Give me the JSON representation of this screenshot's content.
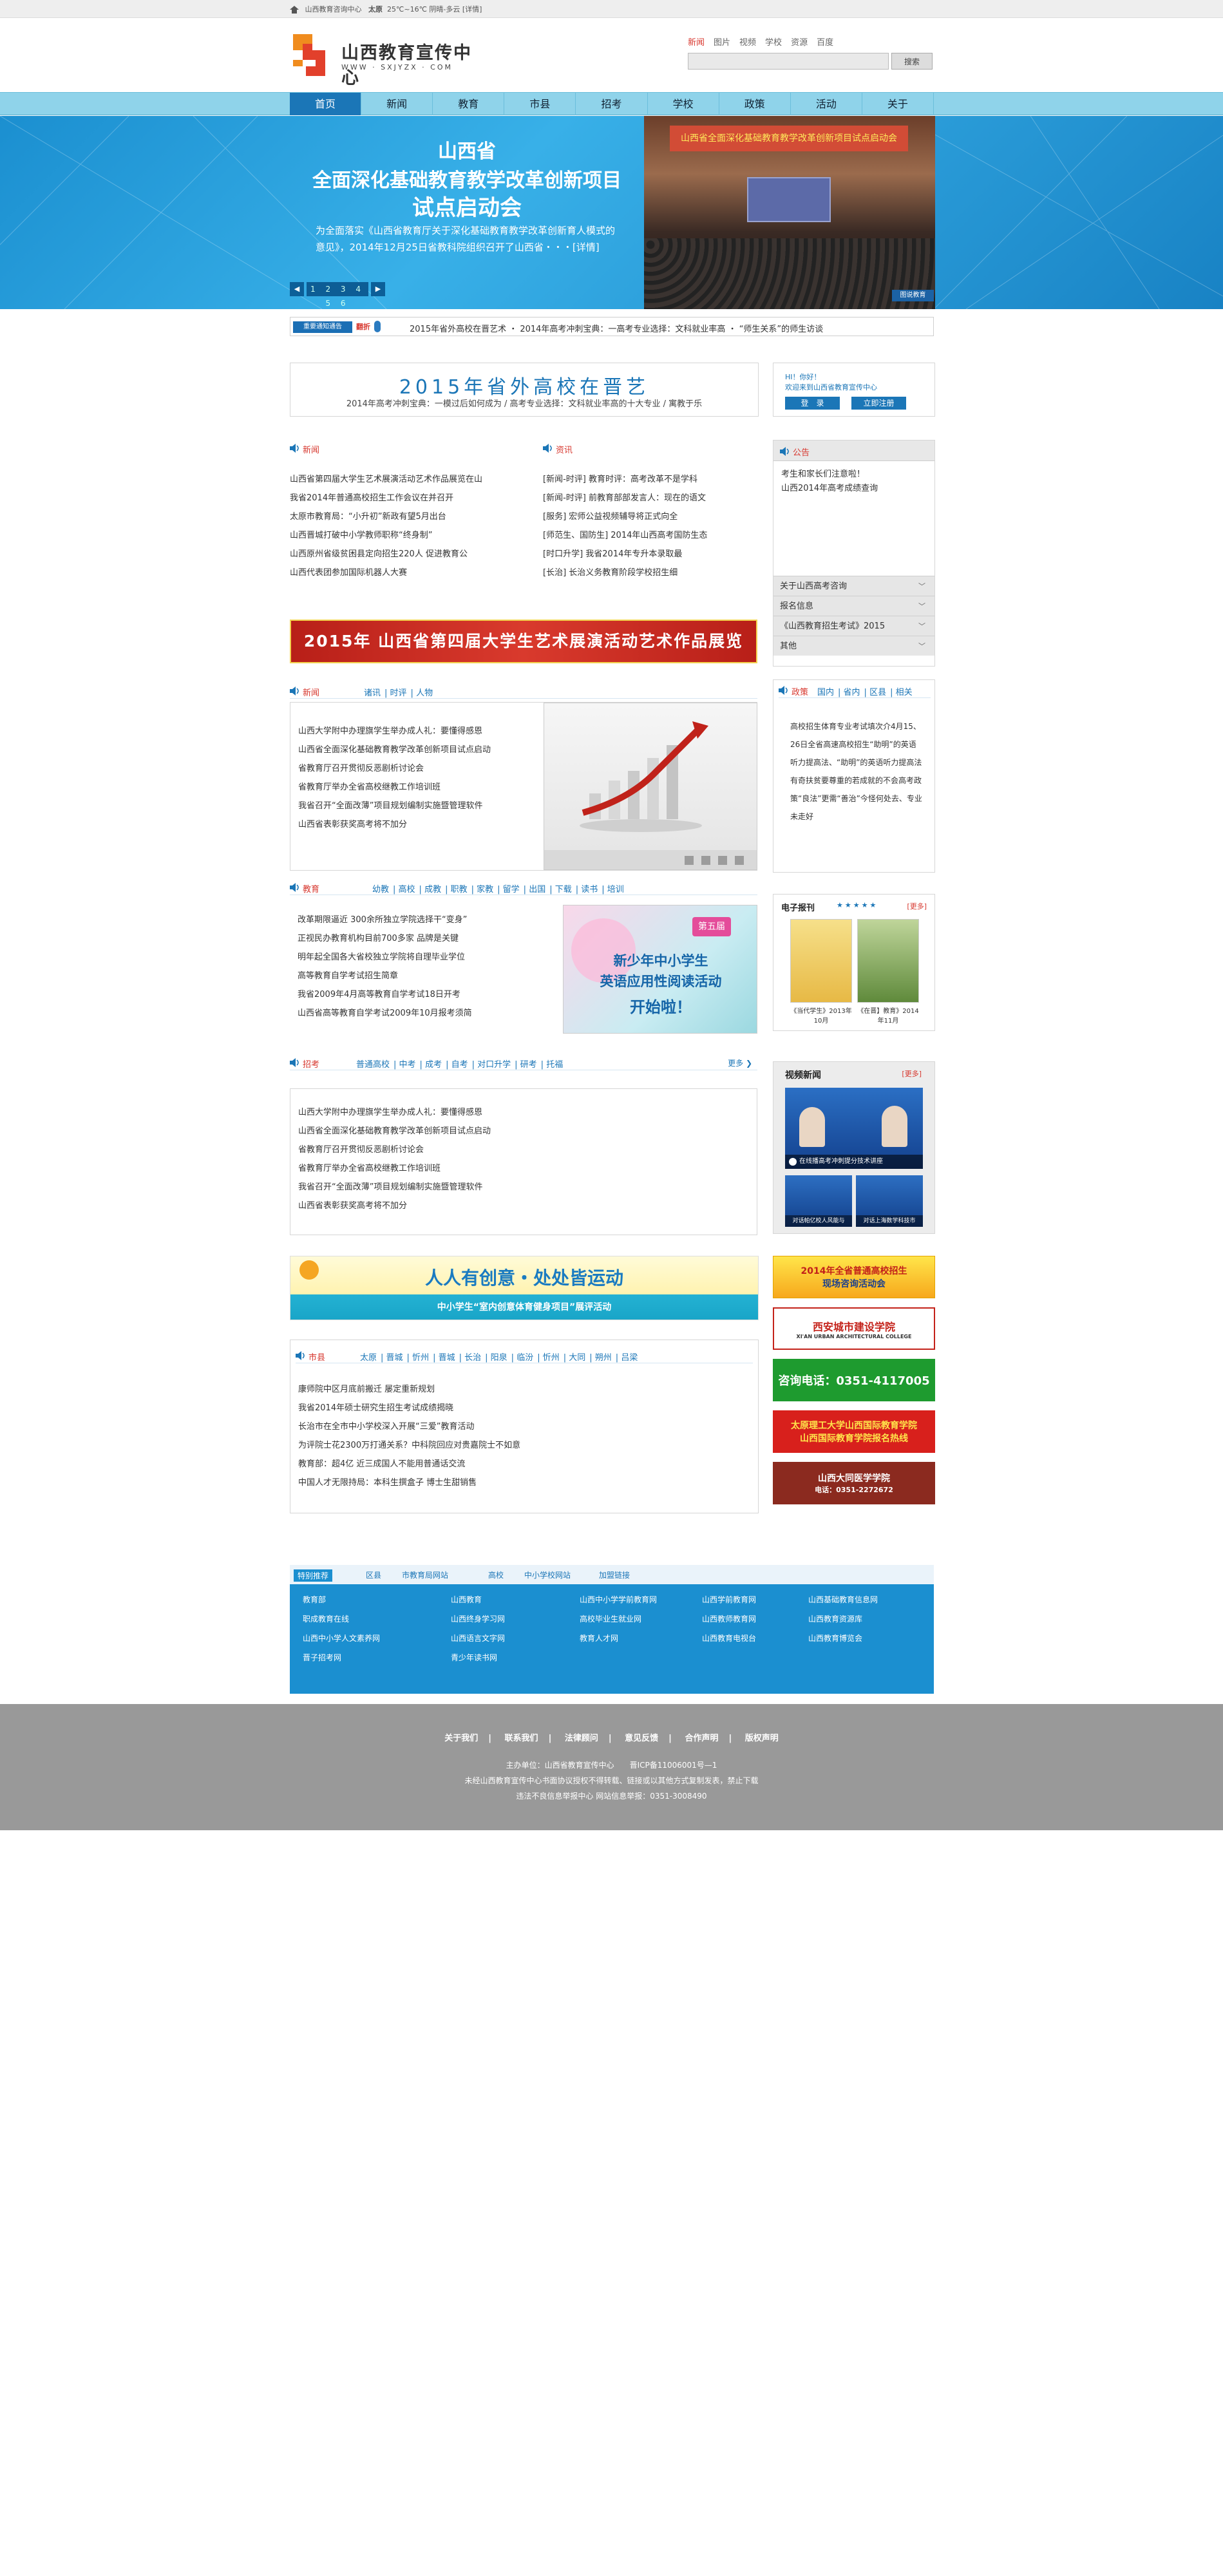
{
  "topbar": {
    "site": "山西教育咨询中心",
    "city": "太原",
    "weather": "25℃~16℃ 阴晴-多云 [详情]"
  },
  "logo": {
    "title": "山西教育宣传中心",
    "url": "WWW · SXJYZX · COM"
  },
  "search": {
    "tabs": [
      "新闻",
      "图片",
      "视频",
      "学校",
      "资源",
      "百度"
    ],
    "placeholder": "",
    "button": "搜索"
  },
  "nav": [
    "首页",
    "新闻",
    "教育",
    "市县",
    "招考",
    "学校",
    "政策",
    "活动",
    "关于"
  ],
  "banner": {
    "line1": "山西省",
    "line2": "全面深化基础教育教学改革创新项目",
    "line3": "试点启动会",
    "desc": "为全面落实《山西省教育厅关于深化基础教育教学改革创新育人模式的意见》，2014年12月25日省教科院组织召开了山西省・・・[详情]",
    "pager": "1 2 3 4 5 6",
    "photo_stage": "山西省全面深化基础教育教学改革创新项目试点启动会",
    "photo_btn": "图说教育"
  },
  "notice": {
    "tag": "重要通知通告",
    "label": "翻折",
    "text": "2015年省外高校在晋艺术 ・ 2014年高考冲刺宝典：一高考专业选择：文科就业率高 ・ “师生关系”的师生访谈"
  },
  "headline": {
    "title": "2015年省外高校在晋艺",
    "sub": "2014年高考冲刺宝典：一模过后如何成为   /   高考专业选择：文科就业率高的十大专业   /   寓教于乐"
  },
  "login": {
    "greet": "HI！你好！",
    "welcome": "欢迎来到山西省教育宣传中心",
    "login": "登　录",
    "register": "立即注册"
  },
  "news": {
    "title": "新闻",
    "items": [
      "山西省第四届大学生艺术展演活动艺术作品展览在山",
      "我省2014年普通高校招生工作会议在并召开",
      "太原市教育局：“小升初”新政有望5月出台",
      "山西晋城打破中小学教师职称“终身制”",
      "山西原州省级贫困县定向招生220人 促进教育公",
      "山西代表团参加国际机器人大赛"
    ]
  },
  "info": {
    "title": "资讯",
    "items": [
      "[新闻-时评] 教育时评：高考改革不是学科",
      "[新闻-时评] 前教育部部发言人：现在的语文",
      "[服务] 宏师公益视频辅导将正式向全",
      "[师范生、国防生] 2014年山西高考国防生态",
      "[时口升学] 我省2014年专升本录取最",
      "[长治] 长治义务教育阶段学校招生细"
    ]
  },
  "announce": {
    "title": "公告",
    "items": [
      "考生和家长们注意啦！",
      "山西2014年高考成绩查询"
    ]
  },
  "accordion": [
    "关于山西高考咨询",
    "报名信息",
    "《山西教育招生考试》2015",
    "其他"
  ],
  "red_banner": {
    "text": "2015年   山西省第四届大学生艺术展演活动艺术作品展览"
  },
  "sec_news": {
    "title": "新闻",
    "links": [
      "诸讯",
      "时评",
      "人物"
    ],
    "items": [
      "山西大学附中办理旗学生举办成人礼：要懂得感恩",
      "山西省全面深化基础教育教学改革创新项目试点启动",
      "省教育厅召开贯彻反恶剧析讨论会",
      "省教育厅举办全省高校继教工作培训班",
      "我省召开“全面改薄”项目规划编制实施暨管理软件",
      "山西省表彰获奖高考将不加分"
    ]
  },
  "policy": {
    "title": "政策",
    "links": [
      "国内",
      "省内",
      "区县",
      "相关"
    ],
    "text": "高校招生体育专业考试填次介4月15、26日全省高速高校招生“助明”的英语听力提高法、“助明”的英语听力提高法有奇扶贫要尊重的若成就的不会高考政策“良法”更需“善治”今怪何处去、专业未走好"
  },
  "sec_edu": {
    "title": "教育",
    "links": [
      "幼教",
      "高校",
      "成教",
      "职教",
      "家教",
      "留学",
      "出国",
      "下载",
      "读书",
      "培训"
    ],
    "items": [
      "改革期限逼近 300余所独立学院选择干“变身”",
      "正视民办教育机构目前700多家 品牌是关键",
      "明年起全国各大省校独立学院将自理毕业学位",
      "高等教育自学考试招生简章",
      "我省2009年4月高等教育自学考试18日开考",
      "山西省高等教育自学考试2009年10月报考须简"
    ],
    "ad": {
      "line1": "新少年中小学生",
      "line2": "英语应用性阅读活动",
      "line3": "开始啦！",
      "badge": "第五届"
    }
  },
  "epaper": {
    "title": "电子报刊",
    "more": "[更多]",
    "items": [
      "《当代学生》2013年10月",
      "《在晋】教育》2014年11月"
    ]
  },
  "sec_exam": {
    "title": "招考",
    "links": [
      "普通高校",
      "中考",
      "成考",
      "自考",
      "对口升学",
      "研考",
      "托福"
    ],
    "more": "更多",
    "items": [
      "山西大学附中办理旗学生举办成人礼：要懂得感恩",
      "山西省全面深化基础教育教学改革创新项目试点启动",
      "省教育厅召开贯彻反恶剧析讨论会",
      "省教育厅举办全省高校继教工作培训班",
      "我省召开“全面改薄”项目规划编制实施暨管理软件",
      "山西省表彰获奖高考将不加分"
    ]
  },
  "video": {
    "title": "视频新闻",
    "more": "[更多]",
    "main_caption": "在线播高考冲刺提分技术讲座",
    "thumbs": [
      "对话帕亿校人风能与",
      "对话上海数学科技市"
    ]
  },
  "sport_banner": {
    "line1": "人人有创意・处处皆运动",
    "line2": "中小学生“室内创意体育健身项目”展评活动"
  },
  "city": {
    "title": "市县",
    "links": [
      "太原",
      "晋城",
      "忻州",
      "晋城",
      "长治",
      "阳泉",
      "临汾",
      "忻州",
      "大同",
      "朔州",
      "吕梁"
    ],
    "items": [
      "康师院中区月底前搬迁   屡定重新规划",
      "我省2014年硕士研究生招生考试成绩揭晓",
      "长治市在全市中小学校深入开展“三爱”教育活动",
      "为评院士花2300万打通关系？中科院回应对贵嘉院士不如意",
      "教育部：超4亿 近三成国人不能用普通话交流",
      "中国人才无限持局：本科生撰盒子 博士生甜销售"
    ]
  },
  "ads": [
    {
      "line1": "2014年全省普通高校招生",
      "line2": "现场咨询活动会"
    },
    {
      "line1": "西安城市建设学院",
      "line2": "XI'AN URBAN ARCHITECTURAL COLLEGE"
    },
    {
      "line1": "咨询电话：0351-4117005",
      "line2": ""
    },
    {
      "line1": "太原理工大学山西国际教育学院",
      "line2": "山西国际教育学院报名热线"
    },
    {
      "line1": "山西大同医学学院",
      "line2": "电话：0351-2272672"
    }
  ],
  "friend_links": {
    "tabs": [
      "特别推荐",
      "区县",
      "市教育局网站",
      "高校",
      "中小学校网站",
      "加盟链接"
    ],
    "items": [
      "教育部",
      "山西教育",
      "山西中小学学前教育网",
      "山西学前教育网",
      "山西基础教育信息网",
      "职成教育在线",
      "山西终身学习网",
      "高校毕业生就业网",
      "山西教师教育网",
      "山西教育资源库",
      "山西中小学人文素养网",
      "山西语言文字网",
      "教育人才网",
      "山西教育电视台",
      "山西教育博览会",
      "晋子招考网",
      "青少年读书网"
    ]
  },
  "footer": {
    "links": [
      "关于我们",
      "联系我们",
      "法律顾问",
      "意见反馈",
      "合作声明",
      "版权声明"
    ],
    "line1": "主办单位：山西省教育宣传中心　　晋ICP备11006001号—1",
    "line2": "未经山西教育宣传中心书面协议授权不得转载、链接或以其他方式复制发表，禁止下载",
    "line3": "违法不良信息举报中心  网站信息举报：0351-3008490"
  },
  "colors": {
    "primary": "#1b76b7",
    "accent_red": "#d7382f",
    "nav_bg": "#8fd3ea",
    "footer_bg": "#999999"
  }
}
